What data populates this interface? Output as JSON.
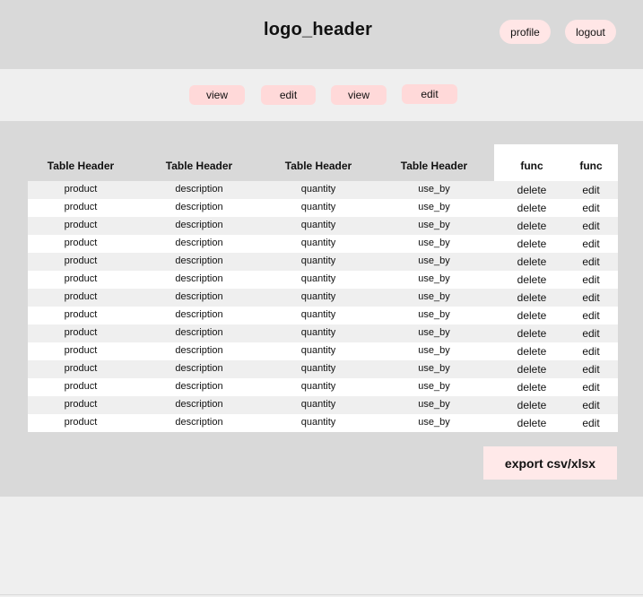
{
  "header": {
    "logo": "logo_header",
    "profile_label": "profile",
    "logout_label": "logout"
  },
  "toolbar": {
    "buttons": [
      "view",
      "edit",
      "view",
      "edit"
    ]
  },
  "table": {
    "headers": [
      "Table Header",
      "Table Header",
      "Table Header",
      "Table Header",
      "func",
      "func"
    ],
    "rows": [
      [
        "product",
        "description",
        "quantity",
        "use_by",
        "delete",
        "edit"
      ],
      [
        "product",
        "description",
        "quantity",
        "use_by",
        "delete",
        "edit"
      ],
      [
        "product",
        "description",
        "quantity",
        "use_by",
        "delete",
        "edit"
      ],
      [
        "product",
        "description",
        "quantity",
        "use_by",
        "delete",
        "edit"
      ],
      [
        "product",
        "description",
        "quantity",
        "use_by",
        "delete",
        "edit"
      ],
      [
        "product",
        "description",
        "quantity",
        "use_by",
        "delete",
        "edit"
      ],
      [
        "product",
        "description",
        "quantity",
        "use_by",
        "delete",
        "edit"
      ],
      [
        "product",
        "description",
        "quantity",
        "use_by",
        "delete",
        "edit"
      ],
      [
        "product",
        "description",
        "quantity",
        "use_by",
        "delete",
        "edit"
      ],
      [
        "product",
        "description",
        "quantity",
        "use_by",
        "delete",
        "edit"
      ],
      [
        "product",
        "description",
        "quantity",
        "use_by",
        "delete",
        "edit"
      ],
      [
        "product",
        "description",
        "quantity",
        "use_by",
        "delete",
        "edit"
      ],
      [
        "product",
        "description",
        "quantity",
        "use_by",
        "delete",
        "edit"
      ],
      [
        "product",
        "description",
        "quantity",
        "use_by",
        "delete",
        "edit"
      ]
    ]
  },
  "footer": {
    "export_label": "export csv/xlsx"
  }
}
